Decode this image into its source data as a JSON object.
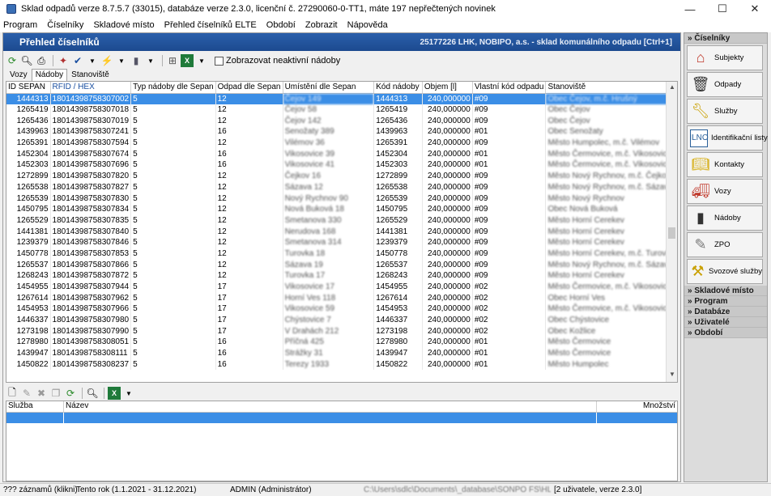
{
  "window": {
    "title": "Sklad odpadů verze 8.7.5.7 (33015), databáze verze 2.3.0, licenční č. 27290060-0-TT1, máte 197 nepřečtených novinek",
    "controls": {
      "minimize": "—",
      "maximize": "☐",
      "close": "✕"
    }
  },
  "menu": [
    "Program",
    "Číselníky",
    "Skladové místo",
    "Přehled číselníků ELTE",
    "Období",
    "Zobrazit",
    "Nápověda"
  ],
  "panel": {
    "title": "Přehled číselníků",
    "right_text": "25177226 LHK, NOBIPO, a.s. - sklad komunálního odpadu [Ctrl+1]"
  },
  "toolbar": {
    "show_inactive_label": "Zobrazovat neaktivní nádoby",
    "show_inactive_checked": false
  },
  "tabs": [
    {
      "label": "Vozy",
      "active": false
    },
    {
      "label": "Nádoby",
      "active": true
    },
    {
      "label": "Stanoviště",
      "active": false
    }
  ],
  "table": {
    "columns": [
      "ID SEPAN",
      "RFID / HEX",
      "Typ nádoby dle Sepan",
      "Odpad dle Sepan",
      "Umístění dle Sepan",
      "Kód nádoby",
      "Objem [l]",
      "Vlastní kód odpadu",
      "Stanoviště"
    ],
    "selected_index": 0,
    "rows": [
      [
        "1444313",
        "18014398758307002",
        "5",
        "12",
        "Čejov 149",
        "1444313",
        "240,000000",
        "#09",
        "Obec Čejov, m.č. Hrušný"
      ],
      [
        "1265419",
        "18014398758307018",
        "5",
        "12",
        "Čejov 58",
        "1265419",
        "240,000000",
        "#09",
        "Obec Čejov"
      ],
      [
        "1265436",
        "18014398758307019",
        "5",
        "12",
        "Čejov 142",
        "1265436",
        "240,000000",
        "#09",
        "Obec Čejov"
      ],
      [
        "1439963",
        "18014398758307241",
        "5",
        "16",
        "Senožaty 389",
        "1439963",
        "240,000000",
        "#01",
        "Obec Senožaty"
      ],
      [
        "1265391",
        "18014398758307594",
        "5",
        "12",
        "Vilémov 36",
        "1265391",
        "240,000000",
        "#09",
        "Město Humpolec, m.č. Vilémov"
      ],
      [
        "1452304",
        "18014398758307674",
        "5",
        "16",
        "Vikosovice 39",
        "1452304",
        "240,000000",
        "#01",
        "Město Čermovice, m.č. Vikosovice"
      ],
      [
        "1452303",
        "18014398758307696",
        "5",
        "16",
        "Vikosovice 41",
        "1452303",
        "240,000000",
        "#01",
        "Město Čermovice, m.č. Vikosovice"
      ],
      [
        "1272899",
        "18014398758307820",
        "5",
        "12",
        "Čejkov 16",
        "1272899",
        "240,000000",
        "#09",
        "Město Nový Rychnov, m.č. Čejkov"
      ],
      [
        "1265538",
        "18014398758307827",
        "5",
        "12",
        "Sázava 12",
        "1265538",
        "240,000000",
        "#09",
        "Město Nový Rychnov, m.č. Sázava"
      ],
      [
        "1265539",
        "18014398758307830",
        "5",
        "12",
        "Nový Rychnov 90",
        "1265539",
        "240,000000",
        "#09",
        "Město Nový Rychnov"
      ],
      [
        "1450795",
        "18014398758307834",
        "5",
        "12",
        "Nová Buková 18",
        "1450795",
        "240,000000",
        "#09",
        "Obec Nová Buková"
      ],
      [
        "1265529",
        "18014398758307835",
        "5",
        "12",
        "Smetanova 330",
        "1265529",
        "240,000000",
        "#09",
        "Město Horní Cerekev"
      ],
      [
        "1441381",
        "18014398758307840",
        "5",
        "12",
        "Nerudova 168",
        "1441381",
        "240,000000",
        "#09",
        "Město Horní Cerekev"
      ],
      [
        "1239379",
        "18014398758307846",
        "5",
        "12",
        "Smetanova 314",
        "1239379",
        "240,000000",
        "#09",
        "Město Horní Cerekev"
      ],
      [
        "1450778",
        "18014398758307853",
        "5",
        "12",
        "Turovka 18",
        "1450778",
        "240,000000",
        "#09",
        "Město Horní Cerekev, m.č. Turovka"
      ],
      [
        "1265537",
        "18014398758307866",
        "5",
        "12",
        "Sázava 19",
        "1265537",
        "240,000000",
        "#09",
        "Město Nový Rychnov, m.č. Sázava"
      ],
      [
        "1268243",
        "18014398758307872",
        "5",
        "12",
        "Turovka 17",
        "1268243",
        "240,000000",
        "#09",
        "Město Horní Cerekev"
      ],
      [
        "1454955",
        "18014398758307944",
        "5",
        "17",
        "Vikosovice 17",
        "1454955",
        "240,000000",
        "#02",
        "Město Čermovice, m.č. Vikosovice"
      ],
      [
        "1267614",
        "18014398758307962",
        "5",
        "17",
        "Horní Ves 118",
        "1267614",
        "240,000000",
        "#02",
        "Obec Horní Ves"
      ],
      [
        "1454953",
        "18014398758307966",
        "5",
        "17",
        "Vikosovice 59",
        "1454953",
        "240,000000",
        "#02",
        "Město Čermovice, m.č. Vikosovice"
      ],
      [
        "1446337",
        "18014398758307980",
        "5",
        "17",
        "Chýstovice 7",
        "1446337",
        "240,000000",
        "#02",
        "Obec Chýstovice"
      ],
      [
        "1273198",
        "18014398758307990",
        "5",
        "17",
        "V Drahách 212",
        "1273198",
        "240,000000",
        "#02",
        "Obec Kožlice"
      ],
      [
        "1278980",
        "18014398758308051",
        "5",
        "16",
        "Příčná 425",
        "1278980",
        "240,000000",
        "#01",
        "Město Čermovice"
      ],
      [
        "1439947",
        "18014398758308111",
        "5",
        "16",
        "Strážky 31",
        "1439947",
        "240,000000",
        "#01",
        "Město Čermovice"
      ],
      [
        "1450822",
        "18014398758308237",
        "5",
        "16",
        "Terezy 1933",
        "1450822",
        "240,000000",
        "#01",
        "Město Humpolec"
      ]
    ]
  },
  "sub_table": {
    "columns": [
      "Služba",
      "Název",
      "Množství"
    ]
  },
  "sidebar": {
    "sections_top": [
      {
        "label": "Číselníky",
        "expanded": true
      }
    ],
    "items": [
      {
        "label": "Subjekty",
        "icon": "houses-icon"
      },
      {
        "label": "Odpady",
        "icon": "trash-bin-icon"
      },
      {
        "label": "Služby",
        "icon": "wrench-icon"
      },
      {
        "label": "Identifikační listy",
        "icon": "document-id-icon"
      },
      {
        "label": "Kontakty",
        "icon": "book-icon"
      },
      {
        "label": "Vozy",
        "icon": "truck-icon"
      },
      {
        "label": "Nádoby",
        "icon": "bin-icon"
      },
      {
        "label": "ZPO",
        "icon": "pencil-paper-icon"
      },
      {
        "label": "Svozové služby",
        "icon": "tools-icon"
      }
    ],
    "sections_bottom": [
      "Skladové místo",
      "Program",
      "Databáze",
      "Uživatelé",
      "Období"
    ]
  },
  "status": {
    "records": "??? záznamů (klikni)",
    "period": "Tento rok (1.1.2021 - 31.12.2021)",
    "user": "ADMIN (Administrátor)",
    "db": "C:\\Users\\sdlc\\Documents\\_database\\SONPO FS\\HL\\DSHK.GDB",
    "info": "[2 uživatele, verze 2.3.0]"
  }
}
